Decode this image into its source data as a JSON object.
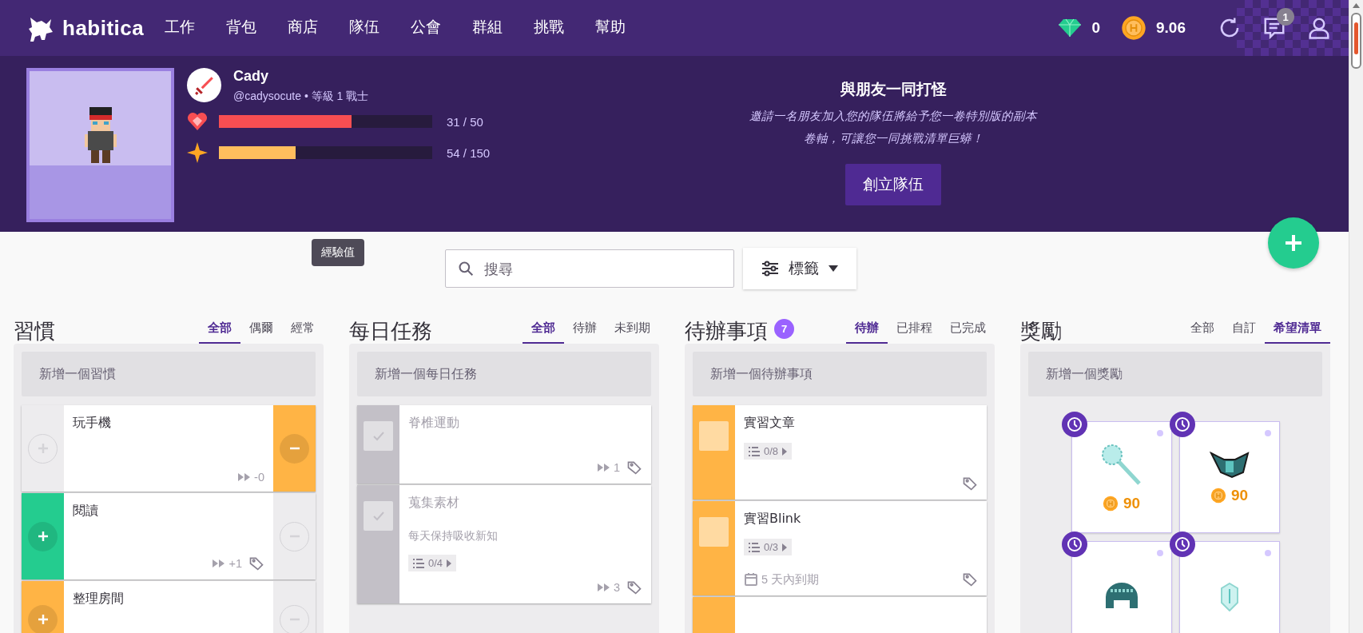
{
  "nav": {
    "logo": "habitica",
    "items": [
      {
        "label": "工作",
        "selected": false
      },
      {
        "label": "背包",
        "selected": false
      },
      {
        "label": "商店",
        "selected": false
      },
      {
        "label": "隊伍",
        "selected": false
      },
      {
        "label": "公會",
        "selected": false
      },
      {
        "label": "群組",
        "selected": false
      },
      {
        "label": "挑戰",
        "selected": false
      },
      {
        "label": "幫助",
        "selected": false
      }
    ],
    "gems": "0",
    "gold": "9.06",
    "notifications": "1"
  },
  "profile": {
    "name": "Cady",
    "subtitle": "@cadysocute • 等級 1 戰士",
    "bars": [
      {
        "kind": "health",
        "level": 0.62,
        "reading": "31 / 50"
      },
      {
        "kind": "experience",
        "level": 0.36,
        "reading": "54 / 150"
      }
    ]
  },
  "party": {
    "title": "與朋友一同打怪",
    "description": "邀請一名朋友加入您的隊伍將給予您一卷特別版的副本卷軸，可讓您一同挑戰清單巨蟒！",
    "button": "創立隊伍"
  },
  "tooltip": "經驗值",
  "search": {
    "placeholder": "搜尋"
  },
  "tags_button": "標籤",
  "columns": [
    {
      "kind": "habits",
      "title": "習慣",
      "tabs": [
        {
          "label": "全部",
          "selected": true
        },
        {
          "label": "偶爾",
          "selected": false
        },
        {
          "label": "經常",
          "selected": false
        }
      ],
      "add": "新增一個習慣",
      "items": [
        {
          "title": "玩手機",
          "color": "#ffb445",
          "up_enabled": false,
          "down_enabled": true,
          "counter": "-0",
          "tagged": false
        },
        {
          "title": "閱讀",
          "color": "#24cc8f",
          "up_enabled": true,
          "down_enabled": false,
          "counter": "+1",
          "tagged": true
        },
        {
          "title": "整理房間",
          "color": "#ffb445",
          "up_enabled": true,
          "down_enabled": false
        }
      ]
    },
    {
      "kind": "dailies",
      "title": "每日任務",
      "tabs": [
        {
          "label": "全部",
          "selected": true
        },
        {
          "label": "待辦",
          "selected": false
        },
        {
          "label": "未到期",
          "selected": false
        }
      ],
      "add": "新增一個每日任務",
      "items": [
        {
          "title": "脊椎運動",
          "due": false,
          "streak": "1",
          "tagged": true
        },
        {
          "title": "蒐集素材",
          "notes": "每天保持吸收新知",
          "checklist": "0/4",
          "due": false,
          "streak": "3",
          "tagged": true
        }
      ]
    },
    {
      "kind": "todos",
      "title": "待辦事項",
      "badge": "7",
      "tabs": [
        {
          "label": "待辦",
          "selected": true
        },
        {
          "label": "已排程",
          "selected": false
        },
        {
          "label": "已完成",
          "selected": false
        }
      ],
      "add": "新增一個待辦事項",
      "items": [
        {
          "title": "實習文章",
          "color": "#ffb445",
          "checklist": "0/8",
          "tagged": true
        },
        {
          "title": "實習Blink",
          "color": "#ffb445",
          "checklist": "0/3",
          "due_text": "5 天內到期",
          "tagged": true
        },
        {
          "color": "#ffb445"
        }
      ]
    },
    {
      "kind": "rewards",
      "title": "獎勵",
      "tabs": [
        {
          "label": "全部",
          "selected": false
        },
        {
          "label": "自訂",
          "selected": false
        },
        {
          "label": "希望清單",
          "selected": true
        }
      ],
      "add": "新增一個獎勵",
      "items": [
        {
          "kind": "staff",
          "price": "90"
        },
        {
          "kind": "armor",
          "price": "90"
        },
        {
          "kind": "helm"
        },
        {
          "kind": "shield"
        }
      ]
    }
  ]
}
